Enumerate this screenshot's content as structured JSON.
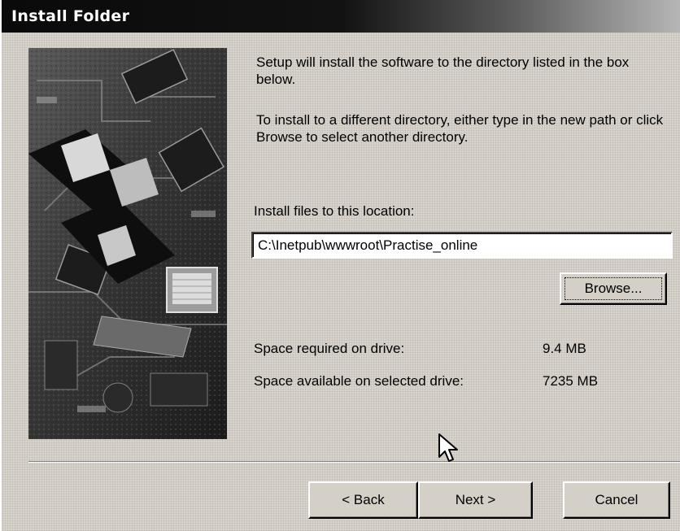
{
  "window": {
    "title": "Install Folder"
  },
  "content": {
    "intro_text": "Setup will install the software to the directory listed in the box below.",
    "instruction_text": "To install to a different directory, either type in the new path or click Browse to select another directory.",
    "location_label": "Install files to this location:",
    "install_path": "C:\\Inetpub\\wwwroot\\Practise_online",
    "browse_label": "Browse...",
    "space_required_label": "Space required on drive:",
    "space_required_value": "9.4 MB",
    "space_available_label": "Space available on selected drive:",
    "space_available_value": "7235 MB"
  },
  "buttons": {
    "back": "< Back",
    "next": "Next >",
    "cancel": "Cancel"
  },
  "colors": {
    "dialog_face": "#d4d0c8",
    "title_bar_start": "#0a0a0a",
    "title_text": "#ffffff"
  }
}
